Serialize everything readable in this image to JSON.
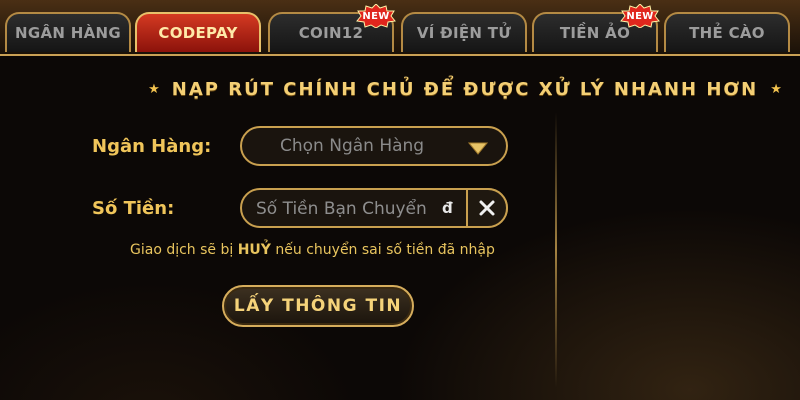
{
  "tabs": [
    {
      "label": "NGÂN HÀNG",
      "active": false,
      "badge": ""
    },
    {
      "label": "CODEPAY",
      "active": true,
      "badge": ""
    },
    {
      "label": "COIN12",
      "active": false,
      "badge": "NEW"
    },
    {
      "label": "VÍ ĐIỆN TỬ",
      "active": false,
      "badge": ""
    },
    {
      "label": "TIỀN ẢO",
      "active": false,
      "badge": "NEW"
    },
    {
      "label": "THẺ CÀO",
      "active": false,
      "badge": ""
    }
  ],
  "heading": {
    "text": "NẠP RÚT CHÍNH CHỦ ĐỂ ĐƯỢC XỬ LÝ NHANH HƠN",
    "star_left": "★",
    "star_right": "★"
  },
  "form": {
    "bank_label": "Ngân Hàng:",
    "bank_select_value": "Chọn Ngân Hàng",
    "amount_label": "Số Tiền:",
    "amount_placeholder": "Số Tiền Bạn Chuyển",
    "amount_value": "",
    "currency_suffix": "đ",
    "note_prefix": "Giao dịch sẽ bị ",
    "note_emphasis": "HUỶ",
    "note_suffix": " nếu chuyển sai số tiền đã nhập",
    "submit_label": "LẤY THÔNG TIN"
  },
  "icons": {
    "dropdown": "caret-down-icon",
    "clear": "close-icon",
    "star": "star-icon",
    "badge": "new-badge-icon"
  },
  "colors": {
    "gold": "#f0c55a",
    "active_tab": "#c72a18",
    "badge": "#e0261d",
    "background": "#0c0806"
  }
}
